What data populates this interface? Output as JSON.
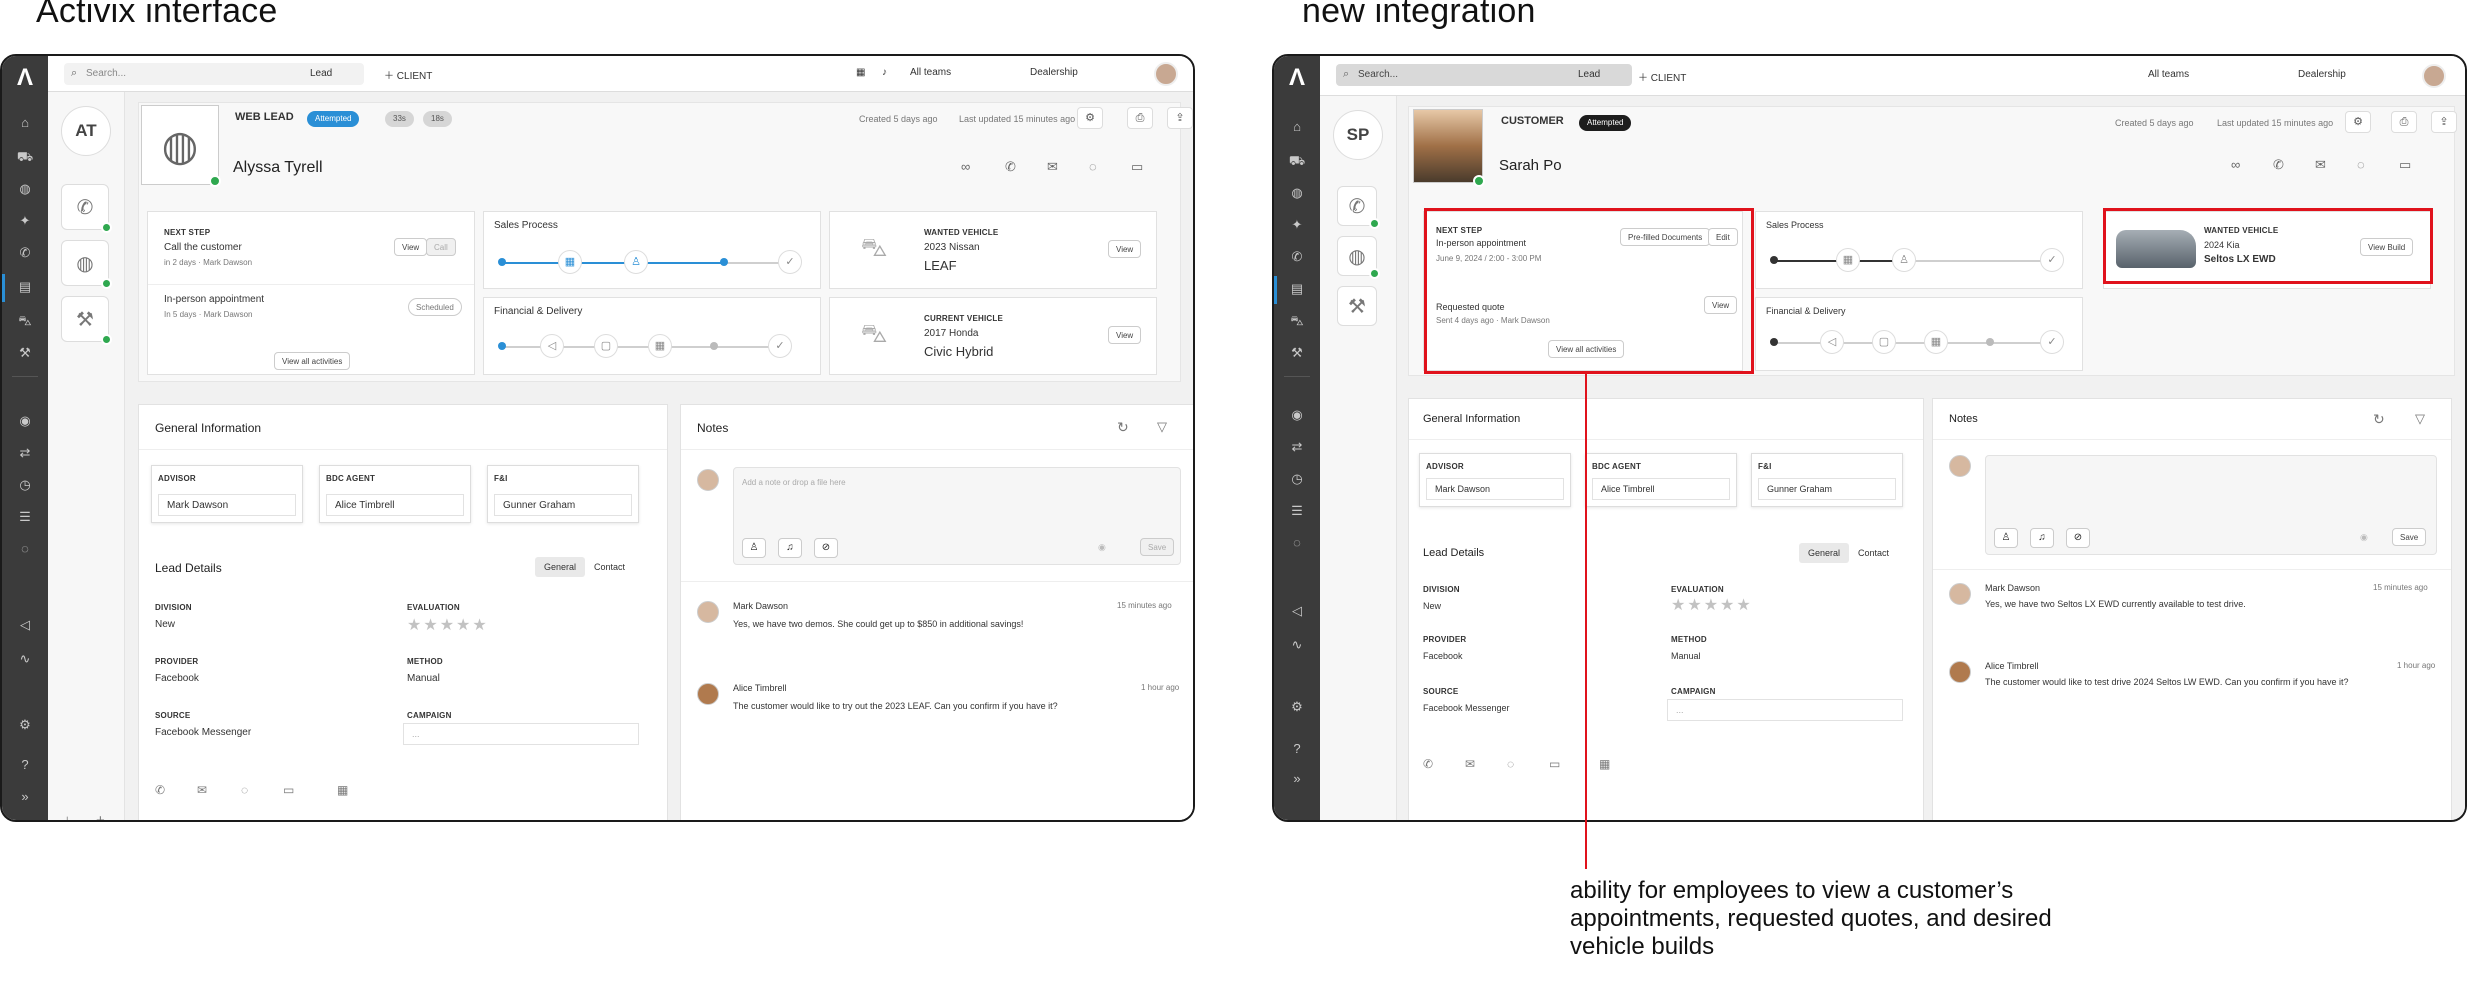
{
  "captions": {
    "left": "Activix interface",
    "right": "new integration"
  },
  "annotation": {
    "text": "ability for employees to view a customer’s appointments, requested quotes, and desired vehicle builds"
  },
  "left": {
    "topbar": {
      "search_placeholder": "Search...",
      "lead_select": "Lead",
      "client_button": "CLIENT",
      "teams": "All teams",
      "dealership": "Dealership"
    },
    "initials": "AT",
    "header": {
      "type": "WEB LEAD",
      "status": "Attempted",
      "chip1": "33s",
      "chip2": "18s",
      "created": "Created 5 days ago",
      "updated": "Last updated 15 minutes ago",
      "name": "Alyssa Tyrell"
    },
    "next_step": {
      "label": "NEXT STEP",
      "title": "Call the customer",
      "sub": "in 2 days · Mark Dawson",
      "btn_view": "View",
      "btn_call": "Call"
    },
    "appt": {
      "title": "In-person appointment",
      "sub": "In 5 days · Mark Dawson",
      "badge": "Scheduled"
    },
    "view_all": "View all activities",
    "sales_process": "Sales Process",
    "financial": "Financial & Delivery",
    "wanted": {
      "label": "WANTED VEHICLE",
      "line1": "2023 Nissan",
      "line2": "LEAF",
      "btn": "View"
    },
    "current": {
      "label": "CURRENT VEHICLE",
      "line1": "2017 Honda",
      "line2": "Civic Hybrid",
      "btn": "View"
    },
    "general_title": "General Information",
    "advisor": {
      "label": "ADVISOR",
      "value": "Mark Dawson"
    },
    "bdc": {
      "label": "BDC AGENT",
      "value": "Alice Timbrell"
    },
    "fi": {
      "label": "F&I",
      "value": "Gunner Graham"
    },
    "lead_details": "Lead Details",
    "tab_general": "General",
    "tab_contact": "Contact",
    "division": {
      "label": "DIVISION",
      "value": "New"
    },
    "evaluation": {
      "label": "EVALUATION"
    },
    "provider": {
      "label": "PROVIDER",
      "value": "Facebook"
    },
    "method": {
      "label": "METHOD",
      "value": "Manual"
    },
    "source": {
      "label": "SOURCE",
      "value": "Facebook Messenger"
    },
    "campaign": {
      "label": "CAMPAIGN",
      "value": "..."
    },
    "notes_title": "Notes",
    "note_placeholder": "Add a note or drop a file here",
    "save": "Save",
    "notes": [
      {
        "author": "Mark Dawson",
        "time": "15 minutes ago",
        "text": "Yes, we have two demos. She could get up to $850 in additional savings!"
      },
      {
        "author": "Alice Timbrell",
        "time": "1 hour ago",
        "text": "The customer would like to try out the 2023 LEAF. Can you confirm if you have it?"
      }
    ]
  },
  "right": {
    "topbar": {
      "search_placeholder": "Search...",
      "lead_select": "Lead",
      "client_button": "CLIENT",
      "teams": "All teams",
      "dealership": "Dealership"
    },
    "initials": "SP",
    "header": {
      "type": "CUSTOMER",
      "status": "Attempted",
      "created": "Created 5 days ago",
      "updated": "Last updated 15 minutes ago",
      "name": "Sarah Po"
    },
    "next_step": {
      "label": "NEXT STEP",
      "title": "In-person appointment",
      "sub": "June 9, 2024 / 2:00 - 3:00 PM",
      "btn_docs": "Pre-filled Documents",
      "btn_edit": "Edit"
    },
    "quote": {
      "title": "Requested quote",
      "sub": "Sent 4 days ago · Mark Dawson",
      "btn": "View"
    },
    "view_all": "View all activities",
    "sales_process": "Sales Process",
    "financial": "Financial & Delivery",
    "wanted": {
      "label": "WANTED VEHICLE",
      "line1": "2024 Kia",
      "line2": "Seltos LX EWD",
      "btn": "View Build"
    },
    "general_title": "General Information",
    "advisor": {
      "label": "ADVISOR",
      "value": "Mark Dawson"
    },
    "bdc": {
      "label": "BDC AGENT",
      "value": "Alice Timbrell"
    },
    "fi": {
      "label": "F&I",
      "value": "Gunner Graham"
    },
    "lead_details": "Lead Details",
    "tab_general": "General",
    "tab_contact": "Contact",
    "division": {
      "label": "DIVISION",
      "value": "New"
    },
    "evaluation": {
      "label": "EVALUATION"
    },
    "provider": {
      "label": "PROVIDER",
      "value": "Facebook"
    },
    "method": {
      "label": "METHOD",
      "value": "Manual"
    },
    "source": {
      "label": "SOURCE",
      "value": "Facebook Messenger"
    },
    "campaign": {
      "label": "CAMPAIGN",
      "value": "..."
    },
    "notes_title": "Notes",
    "save": "Save",
    "notes": [
      {
        "author": "Mark Dawson",
        "time": "15 minutes ago",
        "text": "Yes, we have two Seltos LX EWD currently available to test drive."
      },
      {
        "author": "Alice Timbrell",
        "time": "1 hour ago",
        "text": "The customer would like to test drive 2024 Seltos LW EWD. Can you confirm if you have it?"
      }
    ]
  },
  "colors": {
    "accent": "#2a8fd6",
    "highlight": "#e0121c",
    "success": "#2fa84f",
    "rail": "#3b3b3b"
  },
  "icons": [
    "search-icon",
    "home-icon",
    "cart-icon",
    "phone-icon",
    "mail-icon",
    "chat-icon",
    "video-icon",
    "gear-icon",
    "print-icon",
    "share-icon",
    "car-icon",
    "calendar-icon",
    "person-icon",
    "check-icon",
    "star-icon",
    "refresh-icon",
    "filter-icon",
    "mic-icon",
    "paperclip-icon",
    "eye-icon",
    "bell-icon",
    "plus-icon",
    "chevron-down-icon",
    "expand-icon"
  ]
}
